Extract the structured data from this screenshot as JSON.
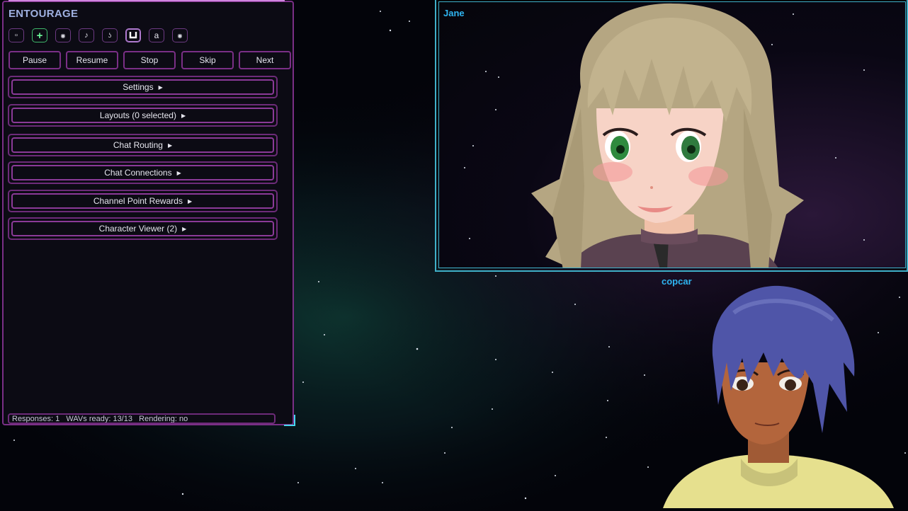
{
  "app": {
    "title": "ENTOURAGE"
  },
  "toolbar_icons": [
    {
      "name": "square-icon",
      "glyph": "▫"
    },
    {
      "name": "add-icon",
      "glyph": "+"
    },
    {
      "name": "radio-dot-icon",
      "glyph": "◉"
    },
    {
      "name": "music-note-icon",
      "glyph": "♪"
    },
    {
      "name": "ear-icon",
      "glyph": "ʖ"
    },
    {
      "name": "magnet-icon",
      "glyph": "⊔"
    },
    {
      "name": "letter-a-icon",
      "glyph": "a"
    },
    {
      "name": "record-icon",
      "glyph": "◉"
    }
  ],
  "controls": {
    "pause": "Pause",
    "resume": "Resume",
    "stop": "Stop",
    "skip": "Skip",
    "next": "Next"
  },
  "sections": [
    {
      "label": "Settings"
    },
    {
      "label": "Layouts (0 selected)"
    },
    {
      "label": "Chat Routing"
    },
    {
      "label": "Chat Connections"
    },
    {
      "label": "Channel Point Rewards"
    },
    {
      "label": "Character Viewer (2)"
    }
  ],
  "status": {
    "text": "Responses: 1   WAVs ready: 13/13   Rendering: no"
  },
  "characters": [
    {
      "name": "Jane"
    },
    {
      "name": "copcar"
    }
  ],
  "colors": {
    "accent_purple": "#7a2f86",
    "accent_cyan": "#3fb0c8",
    "name_blue": "#2fb4f0",
    "active_green": "#3fb86b"
  }
}
